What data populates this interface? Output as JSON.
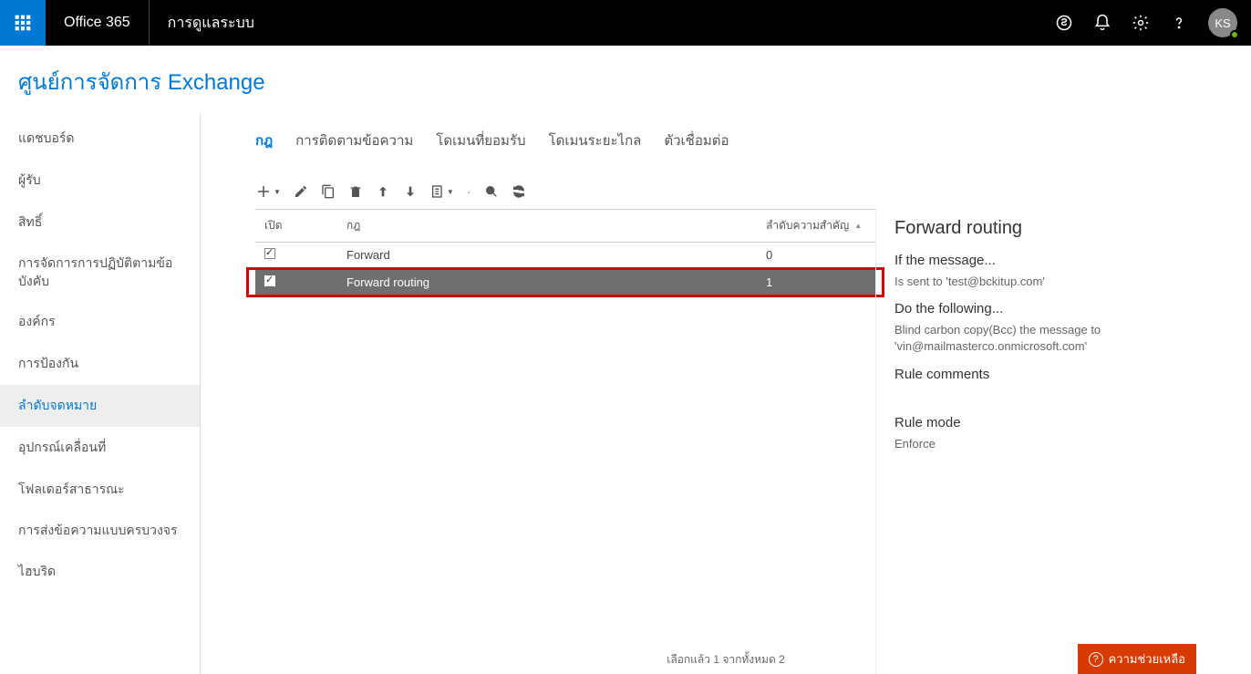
{
  "topbar": {
    "brand": "Office 365",
    "portal": "การดูแลระบบ",
    "avatar_initials": "KS"
  },
  "page_title": "ศูนย์การจัดการ Exchange",
  "sidebar": {
    "items": [
      {
        "label": "แดชบอร์ด"
      },
      {
        "label": "ผู้รับ"
      },
      {
        "label": "สิทธิ์"
      },
      {
        "label": "การจัดการการปฏิบัติตามข้อบังคับ"
      },
      {
        "label": "องค์กร"
      },
      {
        "label": "การป้องกัน"
      },
      {
        "label": "ลำดับจดหมาย",
        "active": true
      },
      {
        "label": "อุปกรณ์เคลื่อนที่"
      },
      {
        "label": "โฟลเดอร์สาธารณะ"
      },
      {
        "label": "การส่งข้อความแบบครบวงจร"
      },
      {
        "label": "ไฮบริด"
      }
    ]
  },
  "tabs": [
    {
      "label": "กฎ",
      "active": true
    },
    {
      "label": "การติดตามข้อความ"
    },
    {
      "label": "โดเมนที่ยอมรับ"
    },
    {
      "label": "โดเมนระยะไกล"
    },
    {
      "label": "ตัวเชื่อมต่อ"
    }
  ],
  "table": {
    "headers": {
      "on": "เปิด",
      "rule": "กฎ",
      "priority": "ลำดับความสำคัญ"
    },
    "rows": [
      {
        "on": true,
        "rule": "Forward",
        "priority": "0",
        "selected": false
      },
      {
        "on": true,
        "rule": "Forward routing",
        "priority": "1",
        "selected": true,
        "highlighted": true
      }
    ]
  },
  "details": {
    "title": "Forward routing",
    "if_title": "If the message...",
    "if_body": "Is sent to 'test@bckitup.com'",
    "do_title": "Do the following...",
    "do_body": "Blind carbon copy(Bcc) the message to 'vin@mailmasterco.onmicrosoft.com'",
    "comments_title": "Rule comments",
    "mode_title": "Rule mode",
    "mode_body": "Enforce"
  },
  "status_line": "เลือกแล้ว 1 จากทั้งหมด 2",
  "help_button": "ความช่วยเหลือ"
}
